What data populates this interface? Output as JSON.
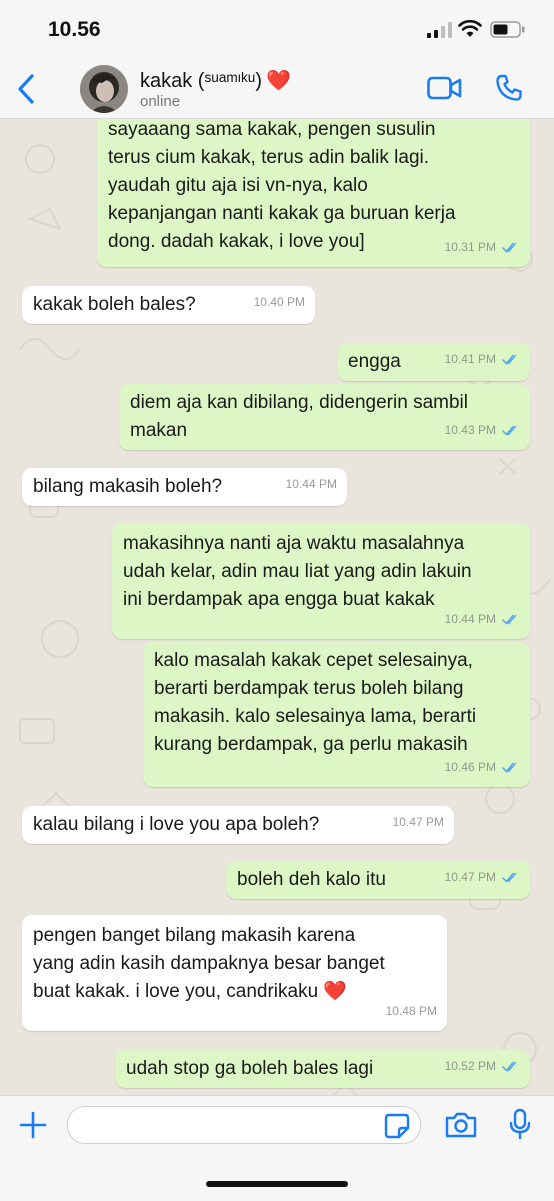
{
  "status_bar": {
    "time": "10.56"
  },
  "header": {
    "contact_name": "kakak (ˢᵘᵃᵐᶦᵏᵘ)",
    "contact_emoji": "❤️",
    "presence": "online"
  },
  "messages": [
    {
      "dir": "out",
      "text": "sayaaang sama kakak, pengen susulin\nterus cium kakak, terus adin balik lagi.\nyaudah gitu aja isi vn-nya, kalo\nkepanjangan nanti kakak ga buruan kerja\ndong. dadah kakak, i love you]",
      "time": "10.31 PM",
      "read": true
    },
    {
      "dir": "in",
      "text": "kakak boleh bales?",
      "time": "10.40 PM"
    },
    {
      "dir": "out",
      "text": "engga",
      "time": "10.41 PM",
      "read": true
    },
    {
      "dir": "out",
      "text": "diem aja kan dibilang, didengerin sambil\nmakan",
      "time": "10.43 PM",
      "read": true
    },
    {
      "dir": "in",
      "text": "bilang makasih boleh?",
      "time": "10.44 PM"
    },
    {
      "dir": "out",
      "text": "makasihnya nanti aja waktu masalahnya\nudah kelar, adin mau liat yang adin lakuin\nini berdampak apa engga buat kakak",
      "time": "10.44 PM",
      "read": true
    },
    {
      "dir": "out",
      "text": "kalo masalah kakak cepet selesainya,\nberarti berdampak terus boleh bilang\nmakasih. kalo selesainya lama, berarti\nkurang berdampak, ga perlu makasih",
      "time": "10.46 PM",
      "read": true
    },
    {
      "dir": "in",
      "text": "kalau bilang i love you apa boleh?",
      "time": "10.47 PM"
    },
    {
      "dir": "out",
      "text": "boleh deh kalo itu",
      "time": "10.47 PM",
      "read": true
    },
    {
      "dir": "in",
      "text": "pengen banget bilang makasih karena\nyang adin kasih dampaknya besar banget\nbuat kakak. i love you, candrikaku ❤️",
      "time": "10.48 PM"
    },
    {
      "dir": "out",
      "text": "udah stop ga boleh bales lagi",
      "time": "10.52 PM",
      "read": true
    }
  ],
  "composer": {
    "placeholder": ""
  },
  "colors": {
    "accent": "#1a7cf5",
    "outgoing_bubble": "#dcf7c5",
    "incoming_bubble": "#ffffff",
    "read_ticks": "#53a6e8"
  }
}
